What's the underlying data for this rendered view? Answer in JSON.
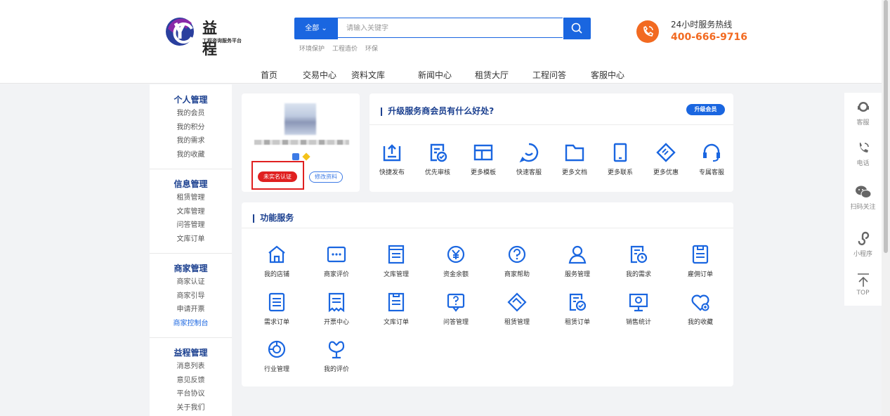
{
  "header": {
    "logo_title": "益 程",
    "logo_subtitle": "工程咨询服务平台",
    "search_category": "全部",
    "search_placeholder": "请输入关键字",
    "hot_keywords": [
      "环境保护",
      "工程造价",
      "环保"
    ],
    "hotline_label": "24小时服务热线",
    "hotline_number": "400-666-9716"
  },
  "nav": [
    "首页",
    "交易中心",
    "资料文库",
    "新闻中心",
    "租赁大厅",
    "工程问答",
    "客服中心"
  ],
  "sidebar": [
    {
      "title": "个人管理",
      "items": [
        "我的会员",
        "我的积分",
        "我的需求",
        "我的收藏"
      ]
    },
    {
      "title": "信息管理",
      "items": [
        "租赁管理",
        "文库管理",
        "问答管理",
        "文库订单"
      ]
    },
    {
      "title": "商家管理",
      "items": [
        "商家认证",
        "商家引导",
        "申请开票",
        "商家控制台"
      ]
    },
    {
      "title": "益程管理",
      "items": [
        "消息列表",
        "意见反馈",
        "平台协议",
        "关于我们"
      ]
    }
  ],
  "profile": {
    "verify_label": "未实名认证",
    "edit_label": "修改资料"
  },
  "upgrade": {
    "title": "升级服务商会员有什么好处?",
    "button": "升级会员",
    "features": [
      "快捷发布",
      "优先审核",
      "更多模板",
      "快速客服",
      "更多文档",
      "更多联系",
      "更多优惠",
      "专属客服"
    ]
  },
  "functions": {
    "title": "功能服务",
    "rows": [
      [
        "我的店铺",
        "商家评价",
        "文库管理",
        "资金余额",
        "商家帮助",
        "服务管理",
        "我的需求",
        "雇佣订单"
      ],
      [
        "需求订单",
        "开票中心",
        "文库订单",
        "问答管理",
        "租赁管理",
        "租赁订单",
        "销售统计",
        "我的收藏"
      ],
      [
        "行业管理",
        "我的评价"
      ]
    ]
  },
  "right_panel": [
    "客服",
    "电话",
    "扫码关注",
    "小程序",
    "TOP"
  ],
  "colors": {
    "primary": "#1a66e0",
    "accent": "#f26a21",
    "alert": "#e02020",
    "heading": "#1a3f8f"
  }
}
